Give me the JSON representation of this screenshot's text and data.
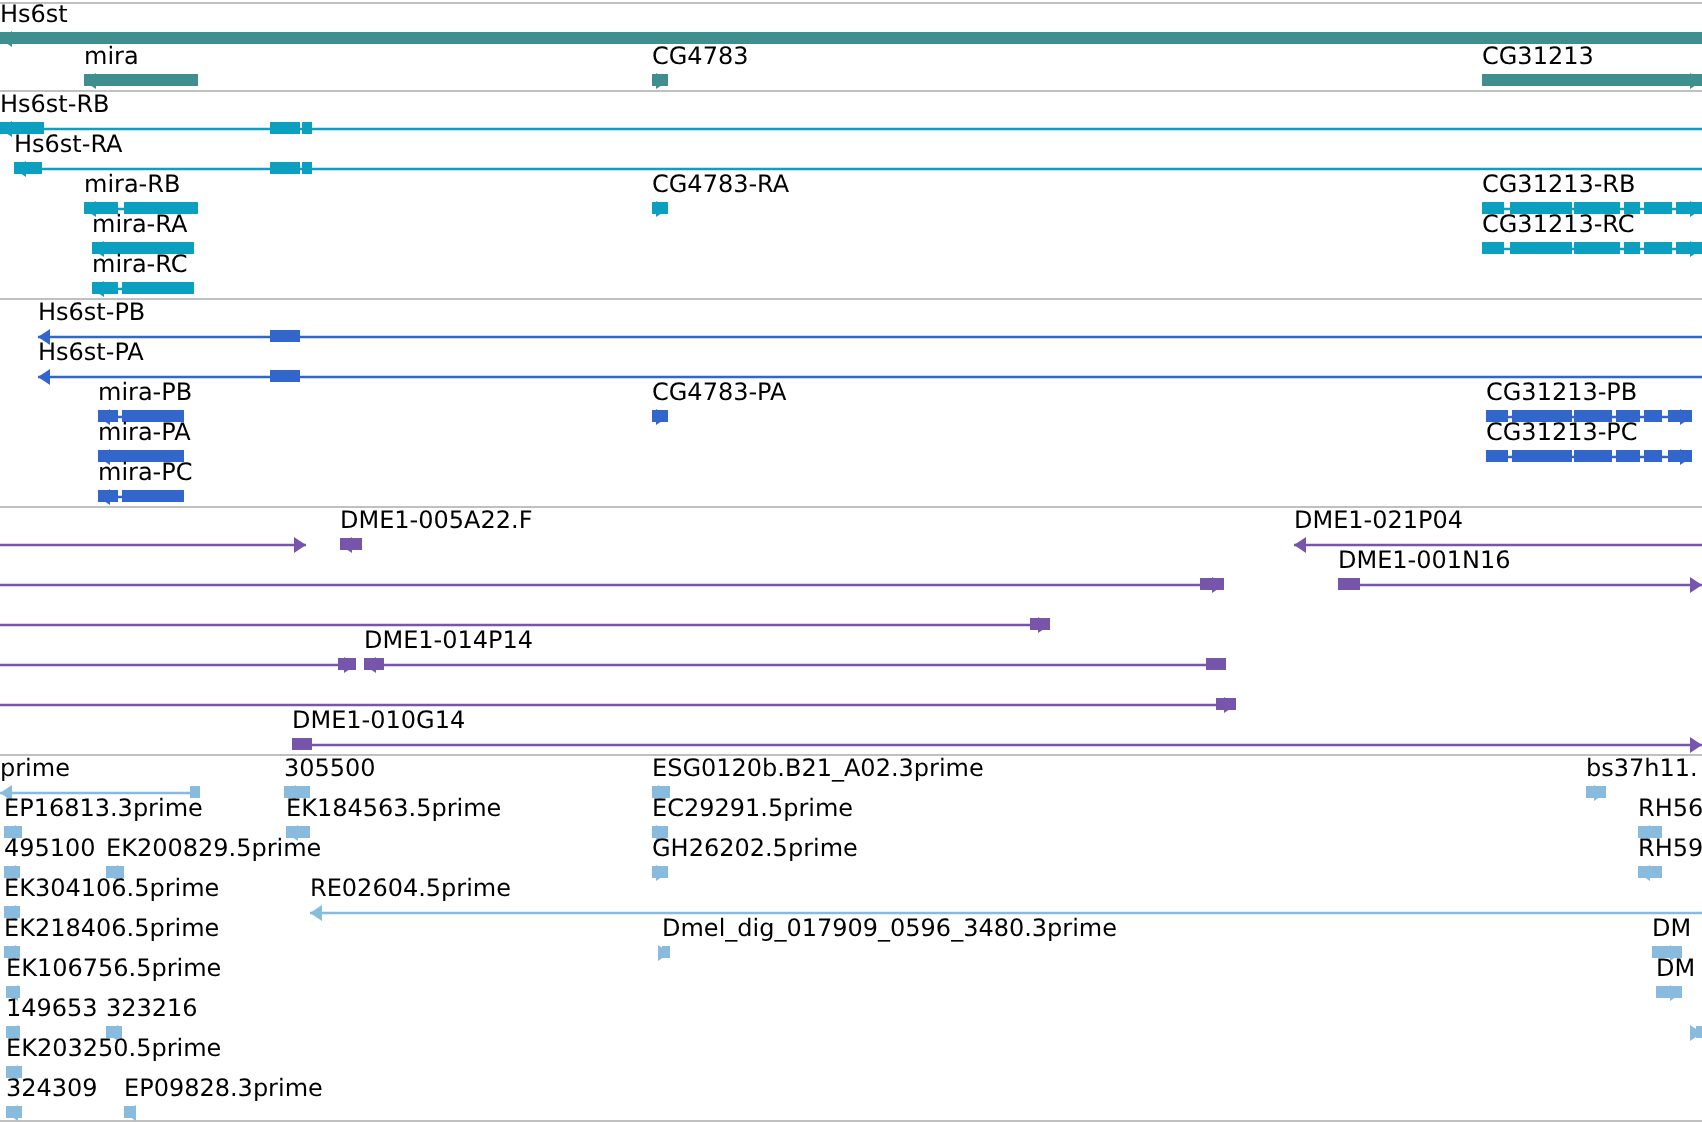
{
  "tracks": [
    {
      "color": "#3f8f8f",
      "features": [
        {
          "label": "Hs6st",
          "reverse": true
        },
        {
          "label": "mira",
          "reverse": true
        },
        {
          "label": "CG4783",
          "reverse": false
        },
        {
          "label": "CG31213",
          "reverse": false
        }
      ]
    },
    {
      "color": "#0ba0c0",
      "features": [
        {
          "label": "Hs6st-RB",
          "reverse": true
        },
        {
          "label": "Hs6st-RA",
          "reverse": true
        },
        {
          "label": "mira-RB",
          "reverse": true
        },
        {
          "label": "CG4783-RA",
          "reverse": false
        },
        {
          "label": "CG31213-RB",
          "reverse": false
        },
        {
          "label": "mira-RA",
          "reverse": true
        },
        {
          "label": "CG31213-RC",
          "reverse": false
        },
        {
          "label": "mira-RC",
          "reverse": true
        }
      ]
    },
    {
      "color": "#3366cc",
      "features": [
        {
          "label": "Hs6st-PB",
          "reverse": true
        },
        {
          "label": "Hs6st-PA",
          "reverse": true
        },
        {
          "label": "mira-PB",
          "reverse": true
        },
        {
          "label": "CG4783-PA",
          "reverse": false
        },
        {
          "label": "CG31213-PB",
          "reverse": false
        },
        {
          "label": "mira-PA",
          "reverse": true
        },
        {
          "label": "CG31213-PC",
          "reverse": false
        },
        {
          "label": "mira-PC",
          "reverse": true
        }
      ]
    },
    {
      "color": "#7755aa",
      "features": [
        {
          "reverse": false
        },
        {
          "label": "DME1-005A22.F",
          "reverse": true
        },
        {
          "label": "DME1-021P04",
          "reverse": true
        },
        {
          "reverse": false
        },
        {
          "label": "DME1-001N16",
          "reverse": false
        },
        {
          "reverse": false
        },
        {
          "reverse": false
        },
        {
          "label": "DME1-014P14",
          "reverse": true
        },
        {
          "reverse": false
        },
        {
          "label": "DME1-010G14",
          "reverse": false
        }
      ]
    },
    {
      "color": "#88bbdd",
      "features": [
        {
          "label": "prime",
          "reverse": true
        },
        {
          "label": "305500",
          "reverse": true
        },
        {
          "label": "ESG0120b.B21_A02.3prime",
          "reverse": false
        },
        {
          "label": "bs37h11.",
          "reverse": false
        },
        {
          "label": "EP16813.3prime",
          "reverse": true
        },
        {
          "label": "EK184563.5prime",
          "reverse": true
        },
        {
          "label": "EC29291.5prime",
          "reverse": false
        },
        {
          "label": "RH56",
          "reverse": true
        },
        {
          "label": "495100",
          "reverse": true
        },
        {
          "label": "EK200829.5prime",
          "reverse": true
        },
        {
          "label": "GH26202.5prime",
          "reverse": false
        },
        {
          "label": "RH59",
          "reverse": true
        },
        {
          "label": "EK304106.5prime",
          "reverse": true
        },
        {
          "label": "RE02604.5prime",
          "reverse": true
        },
        {
          "label": "EK218406.5prime",
          "reverse": true
        },
        {
          "label": "Dmel_dig_017909_0596_3480.3prime",
          "reverse": false
        },
        {
          "label": "DM",
          "reverse": false
        },
        {
          "label": "EK106756.5prime",
          "reverse": true
        },
        {
          "label": "DM",
          "reverse": false
        },
        {
          "label": "149653",
          "reverse": true
        },
        {
          "label": "323216",
          "reverse": true
        },
        {
          "reverse": false
        },
        {
          "label": "EK203250.5prime",
          "reverse": true
        },
        {
          "label": "324309",
          "reverse": true
        },
        {
          "label": "EP09828.3prime",
          "reverse": true
        }
      ]
    }
  ]
}
